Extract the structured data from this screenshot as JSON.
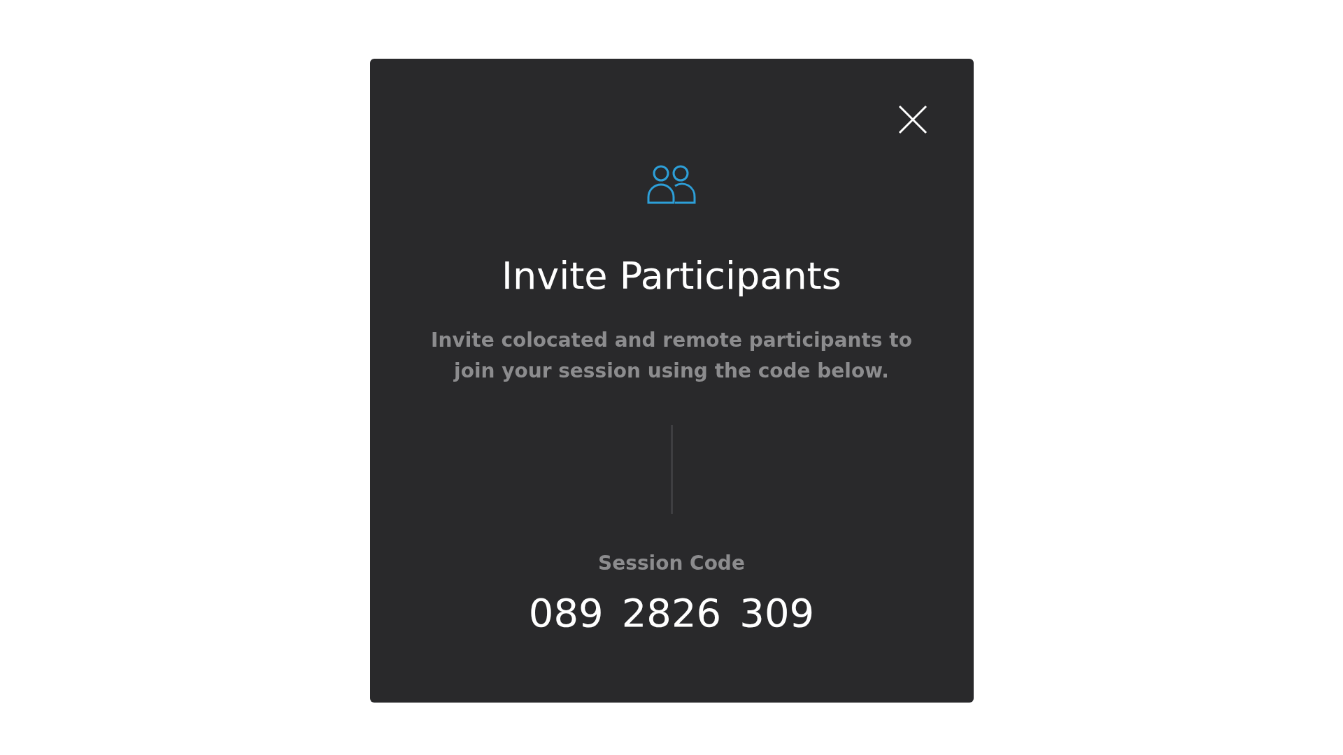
{
  "dialog": {
    "title": "Invite Participants",
    "description": "Invite colocated and remote participants to join your session using the code below.",
    "session_code": {
      "label": "Session Code",
      "groups": [
        "089",
        "2826",
        "309"
      ]
    }
  }
}
